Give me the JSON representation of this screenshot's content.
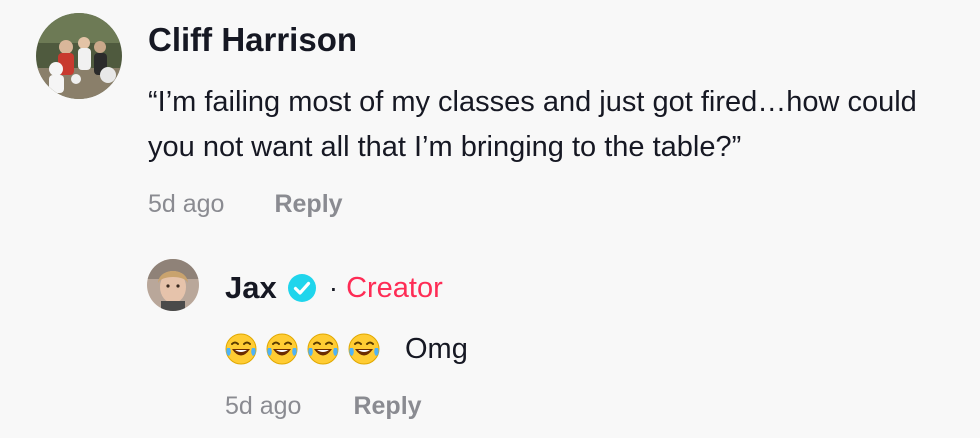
{
  "comment": {
    "author": "Cliff Harrison",
    "avatar_icon": "group-photo-avatar",
    "text": "“I’m failing most of my classes and just got fired…how could you not want all that I’m bringing to the table?”",
    "time": "5d ago",
    "reply_label": "Reply"
  },
  "reply": {
    "author": "Jax",
    "avatar_icon": "person-photo-avatar",
    "verified_icon": "verified-badge-icon",
    "separator": "·",
    "badge": "Creator",
    "emoji_icon": "face-with-tears-of-joy-emoji",
    "emoji_count": 4,
    "text": "Omg",
    "time": "5d ago",
    "reply_label": "Reply"
  },
  "colors": {
    "background": "#f8f8f8",
    "text_primary": "#161823",
    "text_secondary": "#8a8b91",
    "creator_accent": "#fe2c55",
    "verified_blue": "#20d5ec"
  }
}
